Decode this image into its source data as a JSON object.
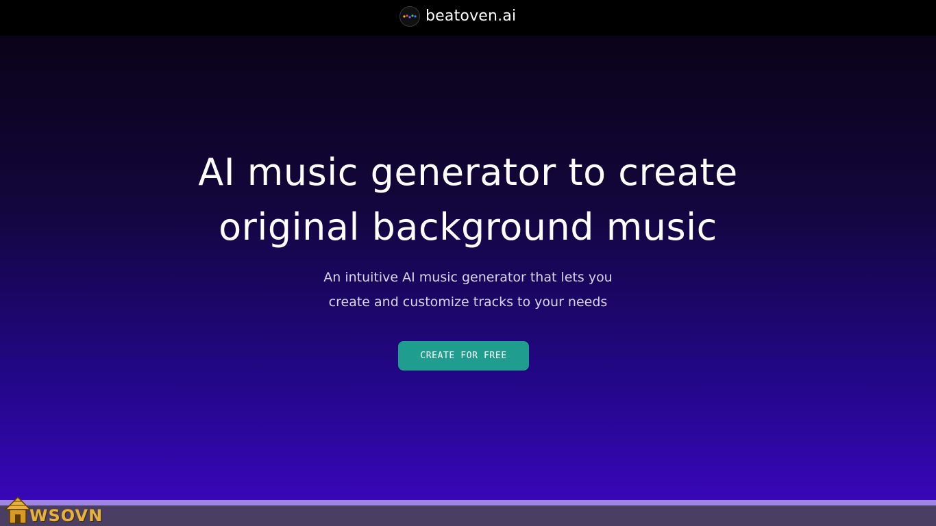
{
  "header": {
    "brand_name": "beatoven.ai",
    "logo_icon": "beatoven-logo-icon",
    "logo_colors": [
      "#f5b82e",
      "#e4405f",
      "#7b5cff",
      "#35c2a6",
      "#3b82f6"
    ]
  },
  "hero": {
    "title_line1": "AI music generator to create",
    "title_line2": "original background music",
    "subtitle_line1": "An intuitive AI music generator that lets you",
    "subtitle_line2": "create and customize tracks to your needs",
    "cta_label": "CREATE FOR FREE"
  },
  "watermark": {
    "text": "WSOVN",
    "icon": "hut-logo-icon"
  },
  "colors": {
    "cta": "#1f9e8f",
    "hero_top": "#0a0318",
    "hero_bottom": "#3807b8",
    "watermark": "#e8b13a"
  }
}
